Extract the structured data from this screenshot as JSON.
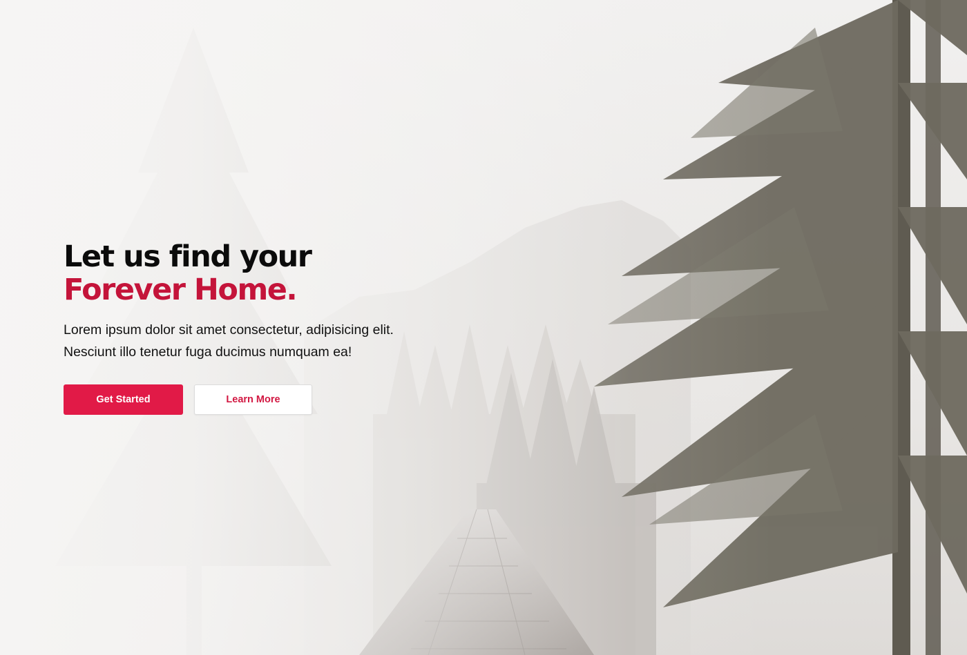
{
  "hero": {
    "headline_line1": "Let us find your",
    "headline_line2": "Forever Home.",
    "lede": "Lorem ipsum dolor sit amet consectetur, adipisicing elit. Nesciunt illo tenetur fuga ducimus numquam ea!",
    "primary_button": "Get Started",
    "secondary_button": "Learn More"
  },
  "colors": {
    "accent": "#e11a47",
    "headline_accent": "#c4143a",
    "text": "#111111",
    "background": "#eeeceb"
  },
  "background_image": "foggy-forest-railway-bridge-photo"
}
